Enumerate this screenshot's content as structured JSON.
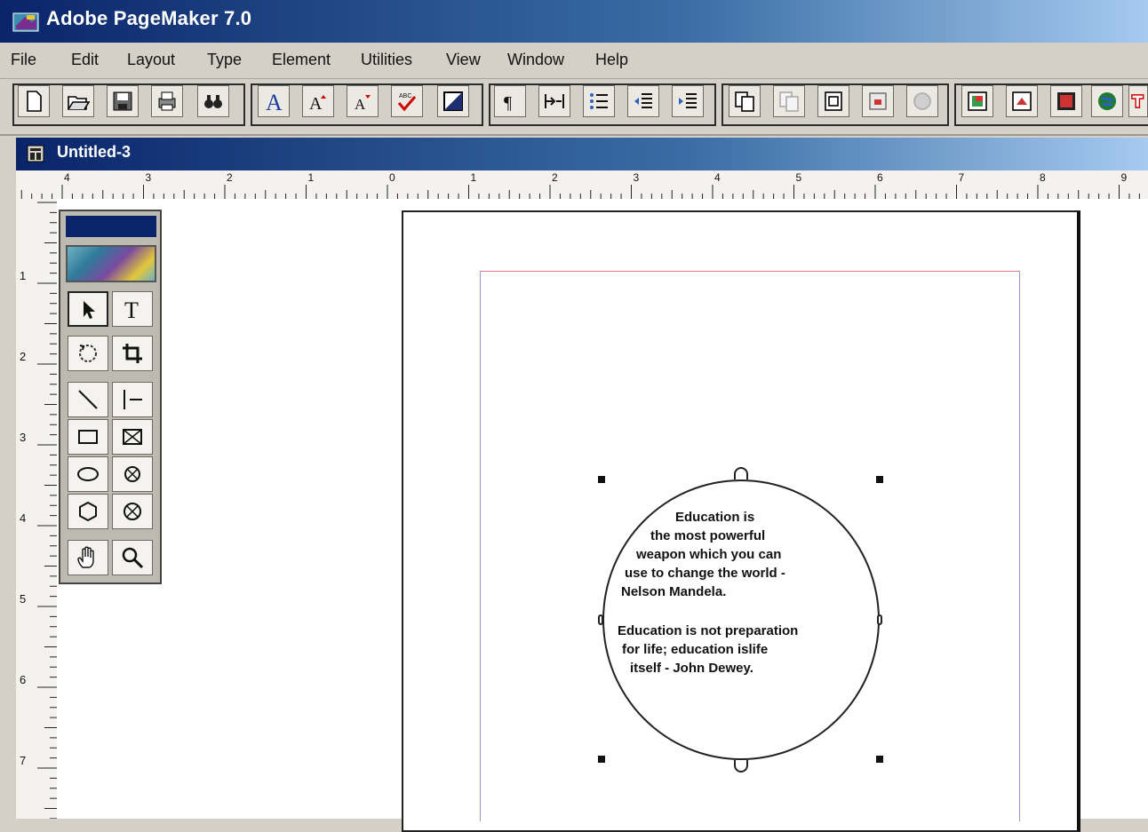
{
  "window": {
    "title": "Adobe PageMaker 7.0"
  },
  "menu": [
    "File",
    "Edit",
    "Layout",
    "Type",
    "Element",
    "Utilities",
    "View",
    "Window",
    "Help"
  ],
  "toolbar": {
    "buttons": [
      "new-icon",
      "open-icon",
      "save-icon",
      "print-icon",
      "find-icon",
      "font-size-icon",
      "increase-font-icon",
      "decrease-font-icon",
      "spell-check-icon",
      "fill-icon",
      "paragraph-icon",
      "indent-icon",
      "bullets-icon",
      "outdent-icon",
      "indent-more-icon",
      "copy-icon",
      "paste-icon",
      "place-icon",
      "frame-icon",
      "globe-disabled-icon",
      "image-icon",
      "export-icon",
      "picture-icon",
      "web-icon",
      "tag-icon"
    ]
  },
  "document": {
    "title": "Untitled-3"
  },
  "ruler": {
    "horizontal_labels": [
      "4",
      "3",
      "2",
      "1",
      "0",
      "1",
      "2",
      "3",
      "4",
      "5",
      "6",
      "7",
      "8",
      "9"
    ],
    "vertical_labels": [
      "1",
      "2",
      "3",
      "4",
      "5",
      "6",
      "7"
    ]
  },
  "toolbox": {
    "tools": [
      "pointer-tool",
      "text-tool",
      "rotate-tool",
      "crop-tool",
      "line-tool",
      "constrained-line-tool",
      "rectangle-tool",
      "rectangle-frame-tool",
      "ellipse-tool",
      "ellipse-frame-tool",
      "polygon-tool",
      "polygon-frame-tool",
      "hand-tool",
      "zoom-tool"
    ],
    "text_tool_glyph": "T"
  },
  "text_frame": {
    "quote1_lines": [
      "Education is",
      "the most powerful",
      "weapon which you can",
      "use to change the world -",
      "Nelson Mandela."
    ],
    "quote2_lines": [
      "Education is not preparation",
      "for life; education islife",
      "itself - John Dewey."
    ]
  }
}
